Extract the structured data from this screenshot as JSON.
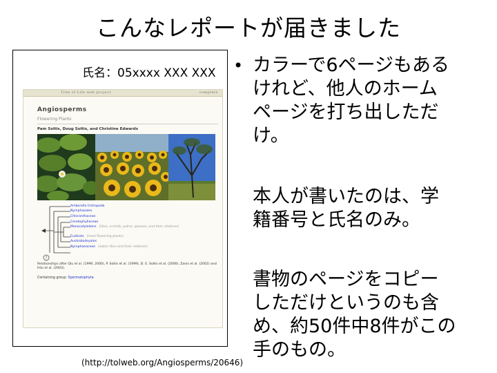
{
  "slide": {
    "title": "こんなレポートが届きました"
  },
  "report": {
    "name_line": "氏名：05xxxx XXX XXX",
    "webpage": {
      "header_left": "Tree of Life web project",
      "header_right": "complete",
      "group_title": "Angiosperms",
      "group_subtitle": "Flowering Plants",
      "authors": "Pam Soltis, Doug Soltis, and Christine Edwards",
      "photos": [
        "water-lily-icon",
        "sunflowers-icon",
        "tree-icon"
      ],
      "tree_leaves": [
        {
          "label": "Amborella trichopoda",
          "note": ""
        },
        {
          "label": "Nymphaeales",
          "note": ""
        },
        {
          "label": "Chloranthaceae",
          "note": ""
        },
        {
          "label": "Ceratophyllaceae",
          "note": ""
        },
        {
          "label": "Monocotyledons",
          "note": "(lilies, orchids, palms, grasses, and their relatives)"
        },
        {
          "label": "Eudicots",
          "note": "(most flowering plants)"
        },
        {
          "label": "Austrobaileyales",
          "note": ""
        },
        {
          "label": "Nymphaeaceae",
          "note": "(water lilies and their relatives)"
        }
      ],
      "references": "Relationships after Qiu et al. (1999, 2000), P. Soltis et al. (1999), D. E. Soltis et al. (2000), Zanis et al. (2002) and Hilu et al. (2003).",
      "containing_label": "Containing group:",
      "containing_link": "Spermatophyta"
    },
    "source_url": "(http://tolweb.org/Angiosperms/20646)"
  },
  "bullets": {
    "para1_line1": "カラーで6ページもある",
    "para1_line2": "けれど、他人のホーム",
    "para1_line3": "ページを打ち出しただ",
    "para1_line4": "け。",
    "para2_line1": "本人が書いたのは、学",
    "para2_line2": "籍番号と氏名のみ。",
    "para3_line1": "書物のページをコピー",
    "para3_line2": "しただけというのも含",
    "para3_line3": "め、約50件中8件がこの",
    "para3_line4": "手のもの。"
  }
}
